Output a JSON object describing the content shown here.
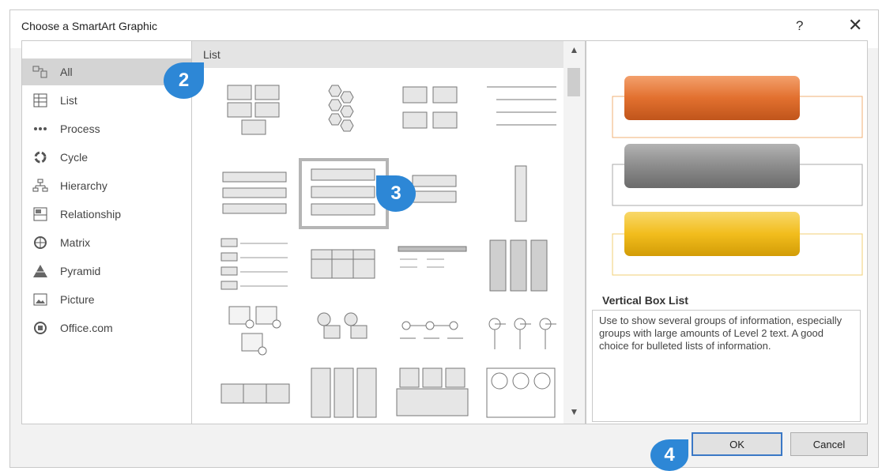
{
  "dialog": {
    "title": "Choose a SmartArt Graphic",
    "help_label": "?",
    "close_label": "✕"
  },
  "categories": [
    {
      "label": "All",
      "icon": "all-icon",
      "selected": true
    },
    {
      "label": "List",
      "icon": "list-icon"
    },
    {
      "label": "Process",
      "icon": "process-icon"
    },
    {
      "label": "Cycle",
      "icon": "cycle-icon"
    },
    {
      "label": "Hierarchy",
      "icon": "hierarchy-icon"
    },
    {
      "label": "Relationship",
      "icon": "relationship-icon"
    },
    {
      "label": "Matrix",
      "icon": "matrix-icon"
    },
    {
      "label": "Pyramid",
      "icon": "pyramid-icon"
    },
    {
      "label": "Picture",
      "icon": "picture-icon"
    },
    {
      "label": "Office.com",
      "icon": "office-icon"
    }
  ],
  "gallery": {
    "header": "List",
    "selected_layout": "Vertical Box List",
    "scroll_up": "▲",
    "scroll_down": "▼"
  },
  "preview": {
    "name": "Vertical Box List",
    "description": "Use to show several groups of information, especially groups with large amounts of Level 2 text. A good choice for bulleted lists of information.",
    "bar_colors": [
      "#e2702f",
      "#8c8c8c",
      "#f2bd1d"
    ],
    "outline_color": "#f0b075"
  },
  "buttons": {
    "ok": "OK",
    "cancel": "Cancel"
  },
  "callouts": [
    "2",
    "3",
    "4"
  ]
}
